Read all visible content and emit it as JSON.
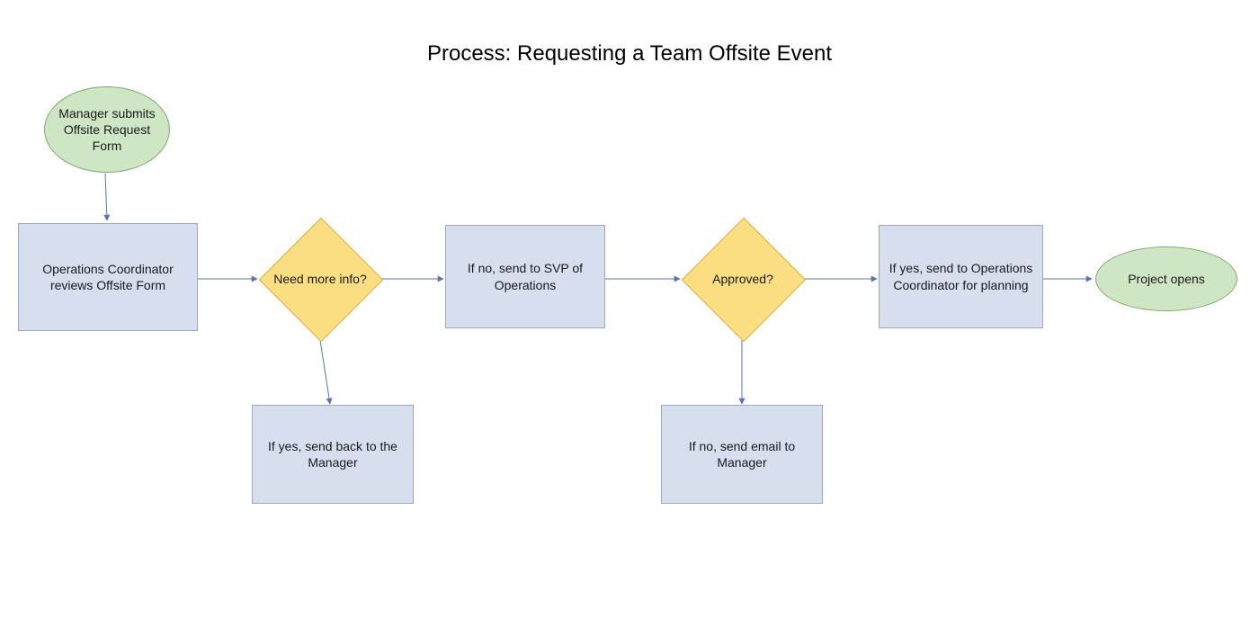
{
  "title": "Process: Requesting a Team Offsite Event",
  "nodes": {
    "start": {
      "label": "Manager submits Offsite Request Form"
    },
    "review": {
      "label": "Operations Coordinator reviews Offsite Form"
    },
    "needInfo": {
      "label": "Need more info?"
    },
    "sendBack": {
      "label": "If yes, send back to the Manager"
    },
    "sendSVP": {
      "label": "If no, send to SVP of Operations"
    },
    "approved": {
      "label": "Approved?"
    },
    "noEmail": {
      "label": "If no, send email to Manager"
    },
    "yesPlan": {
      "label": "If yes, send to Operations Coordinator for planning"
    },
    "end": {
      "label": "Project opens"
    }
  },
  "colors": {
    "ellipseFill": "#cfe6c5",
    "ellipseStroke": "#7fa96e",
    "rectFill": "#d7dfef",
    "rectStroke": "#9aa8c4",
    "diamondFill": "#fbdd82",
    "diamondStroke": "#d4b341",
    "connector": "#5a73b8"
  },
  "chart_data": {
    "type": "diagram",
    "subtype": "flowchart",
    "title": "Process: Requesting a Team Offsite Event",
    "nodes": [
      {
        "id": "start",
        "shape": "ellipse",
        "label": "Manager submits Offsite Request Form"
      },
      {
        "id": "review",
        "shape": "rect",
        "label": "Operations Coordinator reviews Offsite Form"
      },
      {
        "id": "needInfo",
        "shape": "diamond",
        "label": "Need more info?"
      },
      {
        "id": "sendBack",
        "shape": "rect",
        "label": "If yes, send back to the Manager"
      },
      {
        "id": "sendSVP",
        "shape": "rect",
        "label": "If no, send to SVP of Operations"
      },
      {
        "id": "approved",
        "shape": "diamond",
        "label": "Approved?"
      },
      {
        "id": "noEmail",
        "shape": "rect",
        "label": "If no, send email to Manager"
      },
      {
        "id": "yesPlan",
        "shape": "rect",
        "label": "If yes, send to Operations Coordinator for planning"
      },
      {
        "id": "end",
        "shape": "ellipse",
        "label": "Project opens"
      }
    ],
    "edges": [
      {
        "from": "start",
        "to": "review"
      },
      {
        "from": "review",
        "to": "needInfo"
      },
      {
        "from": "needInfo",
        "to": "sendBack",
        "condition": "yes"
      },
      {
        "from": "needInfo",
        "to": "sendSVP",
        "condition": "no"
      },
      {
        "from": "sendSVP",
        "to": "approved"
      },
      {
        "from": "approved",
        "to": "noEmail",
        "condition": "no"
      },
      {
        "from": "approved",
        "to": "yesPlan",
        "condition": "yes"
      },
      {
        "from": "yesPlan",
        "to": "end"
      }
    ]
  }
}
